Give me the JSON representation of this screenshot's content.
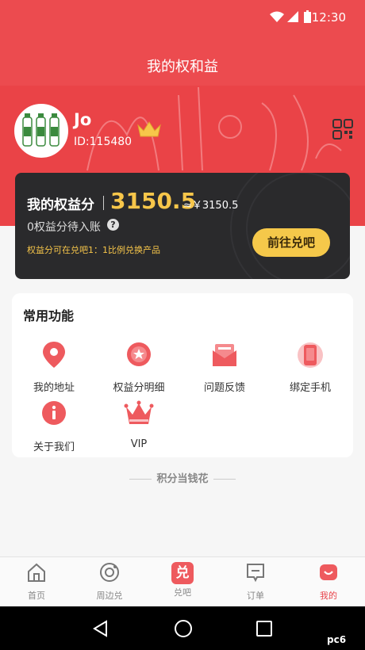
{
  "status_bar": {
    "time": "12:30"
  },
  "page": {
    "title": "我的权和益"
  },
  "user": {
    "name": "Jo",
    "id_text": "ID:115480"
  },
  "points_card": {
    "label": "我的权益分",
    "points": "3150.5",
    "approx": "≈￥3150.5",
    "pending": "0权益分待入账",
    "help": "?",
    "note": "权益分可在兑吧1：1比例兑换产品",
    "action": "前往兑吧"
  },
  "functions": {
    "heading": "常用功能",
    "items": [
      {
        "label": "我的地址",
        "icon": "location-pin-icon"
      },
      {
        "label": "权益分明细",
        "icon": "star-badge-icon"
      },
      {
        "label": "问题反馈",
        "icon": "envelope-icon"
      },
      {
        "label": "绑定手机",
        "icon": "phone-icon"
      },
      {
        "label": "关于我们",
        "icon": "info-icon"
      },
      {
        "label": "VIP",
        "icon": "crown-icon"
      }
    ]
  },
  "slogan": "积分当钱花",
  "bottom_nav": [
    {
      "label": "首页",
      "icon": "home-icon"
    },
    {
      "label": "周边兑",
      "icon": "target-icon"
    },
    {
      "label": "兑吧",
      "icon": "duiba-icon",
      "glyph": "兑"
    },
    {
      "label": "订单",
      "icon": "order-icon"
    },
    {
      "label": "我的",
      "icon": "smile-bag-icon",
      "active": true
    }
  ],
  "watermark": "pc6",
  "colors": {
    "brand_red": "#ec4b4f",
    "gold": "#f7c64a",
    "card_dark": "#2a2a2c"
  }
}
